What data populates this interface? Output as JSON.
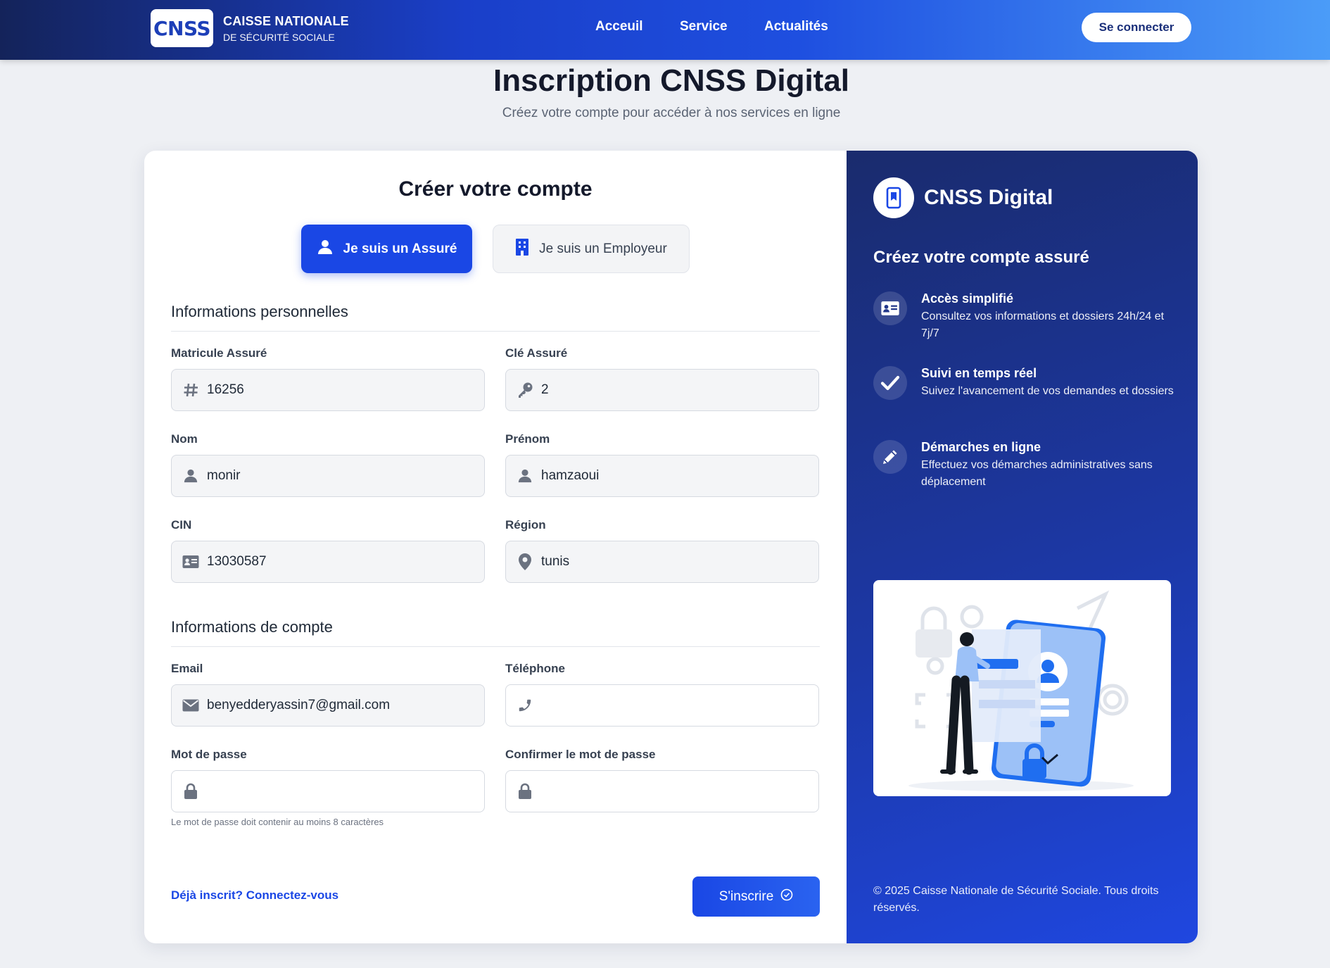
{
  "navbar": {
    "logo_text": "CNSS",
    "org_line1": "CAISSE NATIONALE",
    "org_line2": "DE SÉCURITÉ SOCIALE",
    "links": [
      "Acceuil",
      "Service",
      "Actualités"
    ],
    "connect_label": "Se connecter"
  },
  "header": {
    "title": "Inscription CNSS Digital",
    "subtitle": "Créez votre compte pour accéder à nos services en ligne"
  },
  "form": {
    "title": "Créer votre compte",
    "type_insured": "Je suis un Assuré",
    "type_employer": "Je suis un Employeur",
    "section_personal": "Informations personnelles",
    "section_account": "Informations de compte",
    "fields": {
      "matricule": {
        "label": "Matricule Assuré",
        "value": "16256",
        "icon": "hash-icon"
      },
      "cle": {
        "label": "Clé Assuré",
        "value": "2",
        "icon": "key-icon"
      },
      "nom": {
        "label": "Nom",
        "value": "monir",
        "icon": "user-icon"
      },
      "prenom": {
        "label": "Prénom",
        "value": "hamzaoui",
        "icon": "user-icon"
      },
      "cin": {
        "label": "CIN",
        "value": "13030587",
        "icon": "id-card-icon"
      },
      "region": {
        "label": "Région",
        "value": "tunis",
        "icon": "map-pin-icon"
      },
      "email": {
        "label": "Email",
        "value": "benyedderyassin7@gmail.com",
        "icon": "envelope-icon"
      },
      "telephone": {
        "label": "Téléphone",
        "value": "",
        "icon": "phone-icon"
      },
      "password": {
        "label": "Mot de passe",
        "value": "",
        "icon": "lock-icon"
      },
      "confirm_password": {
        "label": "Confirmer le mot de passe",
        "value": "",
        "icon": "lock-icon"
      }
    },
    "password_hint": "Le mot de passe doit contenir au moins 8 caractères",
    "login_link": "Déjà inscrit? Connectez-vous",
    "submit_label": "S'inscrire"
  },
  "side": {
    "brand": "CNSS Digital",
    "heading": "Créez votre compte assuré",
    "features": [
      {
        "title": "Accès simplifié",
        "desc": "Consultez vos informations et dossiers 24h/24 et 7j/7",
        "icon": "id-card-icon"
      },
      {
        "title": "Suivi en temps réel",
        "desc": "Suivez l'avancement de vos demandes et dossiers",
        "icon": "check-icon"
      },
      {
        "title": "Démarches en ligne",
        "desc": "Effectuez vos démarches administratives sans déplacement",
        "icon": "pencil-icon"
      }
    ],
    "copyright": "© 2025 Caisse Nationale de Sécurité Sociale. Tous droits réservés."
  },
  "colors": {
    "primary": "#1a47e5",
    "nav_dark": "#14235a",
    "nav_light": "#4b9cf8",
    "side_dark": "#1a2b6d"
  }
}
